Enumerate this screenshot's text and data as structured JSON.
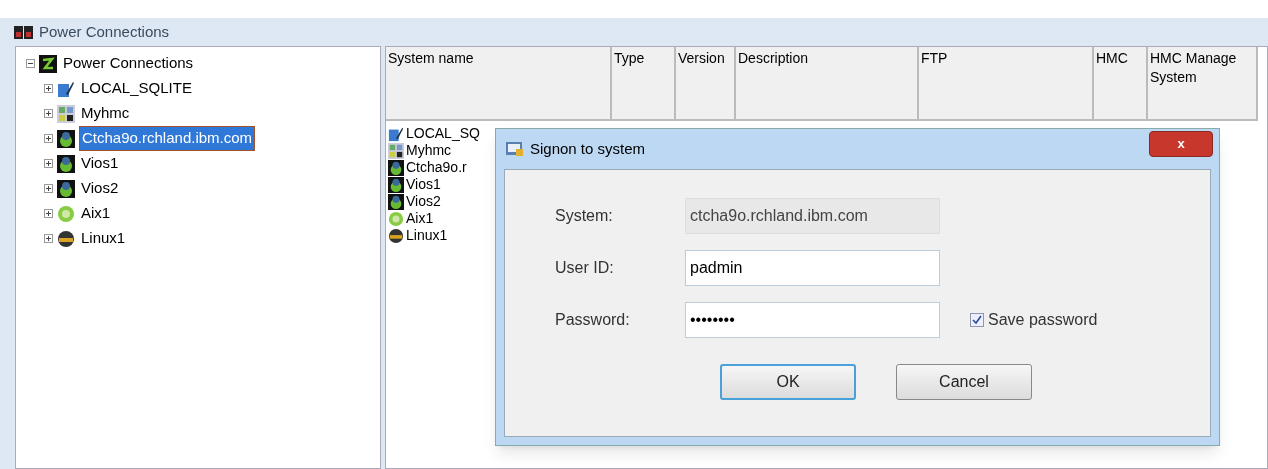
{
  "window": {
    "title": "Power Connections"
  },
  "tree": {
    "label": "Power Connections",
    "expanded": true,
    "kind": "power",
    "selected": false,
    "children": [
      {
        "label": "LOCAL_SQLITE",
        "kind": "sqlite",
        "selected": false
      },
      {
        "label": "Myhmc",
        "kind": "hmc",
        "selected": false
      },
      {
        "label": "Ctcha9o.rchland.ibm.com",
        "kind": "vios",
        "selected": true
      },
      {
        "label": "Vios1",
        "kind": "vios",
        "selected": false
      },
      {
        "label": "Vios2",
        "kind": "vios",
        "selected": false
      },
      {
        "label": "Aix1",
        "kind": "aix",
        "selected": false
      },
      {
        "label": "Linux1",
        "kind": "linux",
        "selected": false
      }
    ]
  },
  "table": {
    "columns": [
      "System name",
      "Type",
      "Version",
      "Description",
      "FTP",
      "HMC",
      "HMC Manage\nSystem"
    ],
    "rows": [
      {
        "kind": "sqlite",
        "name": "LOCAL_SQ"
      },
      {
        "kind": "hmc",
        "name": "Myhmc"
      },
      {
        "kind": "vios",
        "name": "Ctcha9o.r"
      },
      {
        "kind": "vios",
        "name": "Vios1"
      },
      {
        "kind": "vios",
        "name": "Vios2"
      },
      {
        "kind": "aix",
        "name": "Aix1"
      },
      {
        "kind": "linux",
        "name": "Linux1"
      }
    ]
  },
  "dialog": {
    "title": "Signon to system",
    "close": "x",
    "fields": [
      {
        "label": "System:",
        "value": "ctcha9o.rchland.ibm.com",
        "disabled": true
      },
      {
        "label": "User ID:",
        "value": "padmin",
        "disabled": false
      },
      {
        "label": "Password:",
        "value": "••••••••",
        "disabled": false
      }
    ],
    "save_password": {
      "label": "Save password",
      "checked": true
    },
    "buttons": [
      {
        "label": "OK",
        "default": true
      },
      {
        "label": "Cancel",
        "default": false
      }
    ]
  }
}
